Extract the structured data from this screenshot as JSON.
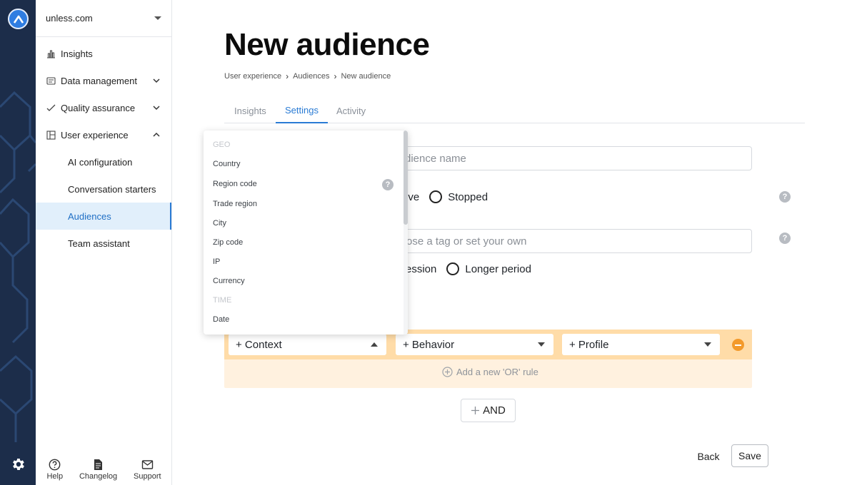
{
  "sidebar": {
    "site": "unless.com",
    "items": [
      {
        "label": "Insights"
      },
      {
        "label": "Data management"
      },
      {
        "label": "Quality assurance"
      },
      {
        "label": "User experience"
      }
    ],
    "sub_items": [
      {
        "label": "AI configuration"
      },
      {
        "label": "Conversation starters"
      },
      {
        "label": "Audiences"
      },
      {
        "label": "Team assistant"
      }
    ],
    "bottom": [
      {
        "label": "Help"
      },
      {
        "label": "Changelog"
      },
      {
        "label": "Support"
      }
    ]
  },
  "page": {
    "title": "New audience",
    "breadcrumb": [
      "User experience",
      "Audiences",
      "New audience"
    ],
    "tabs": [
      {
        "label": "Insights"
      },
      {
        "label": "Settings"
      },
      {
        "label": "Activity"
      }
    ]
  },
  "form": {
    "name_placeholder_visible": "dience name",
    "status_options_visible": [
      "ive",
      "Stopped"
    ],
    "tag_placeholder_visible": "ose a tag or set your own",
    "duration_options_visible": [
      "ession",
      "Longer period"
    ]
  },
  "rule": {
    "selects": [
      {
        "label": "+ Context",
        "open": true
      },
      {
        "label": "+ Behavior",
        "open": false
      },
      {
        "label": "+ Profile",
        "open": false
      }
    ],
    "or_rule_label": "Add a new 'OR' rule",
    "and_label": "AND"
  },
  "actions": {
    "back": "Back",
    "save": "Save"
  },
  "dropdown": {
    "groups": [
      {
        "label": "GEO",
        "items": [
          "Country",
          "Region code",
          "Trade region",
          "City",
          "Zip code",
          "IP",
          "Currency"
        ]
      },
      {
        "label": "TIME",
        "items": [
          "Date"
        ]
      }
    ]
  },
  "colors": {
    "rail": "#1c2d4a",
    "accent": "#2a7bd4",
    "rule_row": "#ffdca8",
    "rule_box": "#fff1df",
    "remove": "#f39a2b"
  }
}
